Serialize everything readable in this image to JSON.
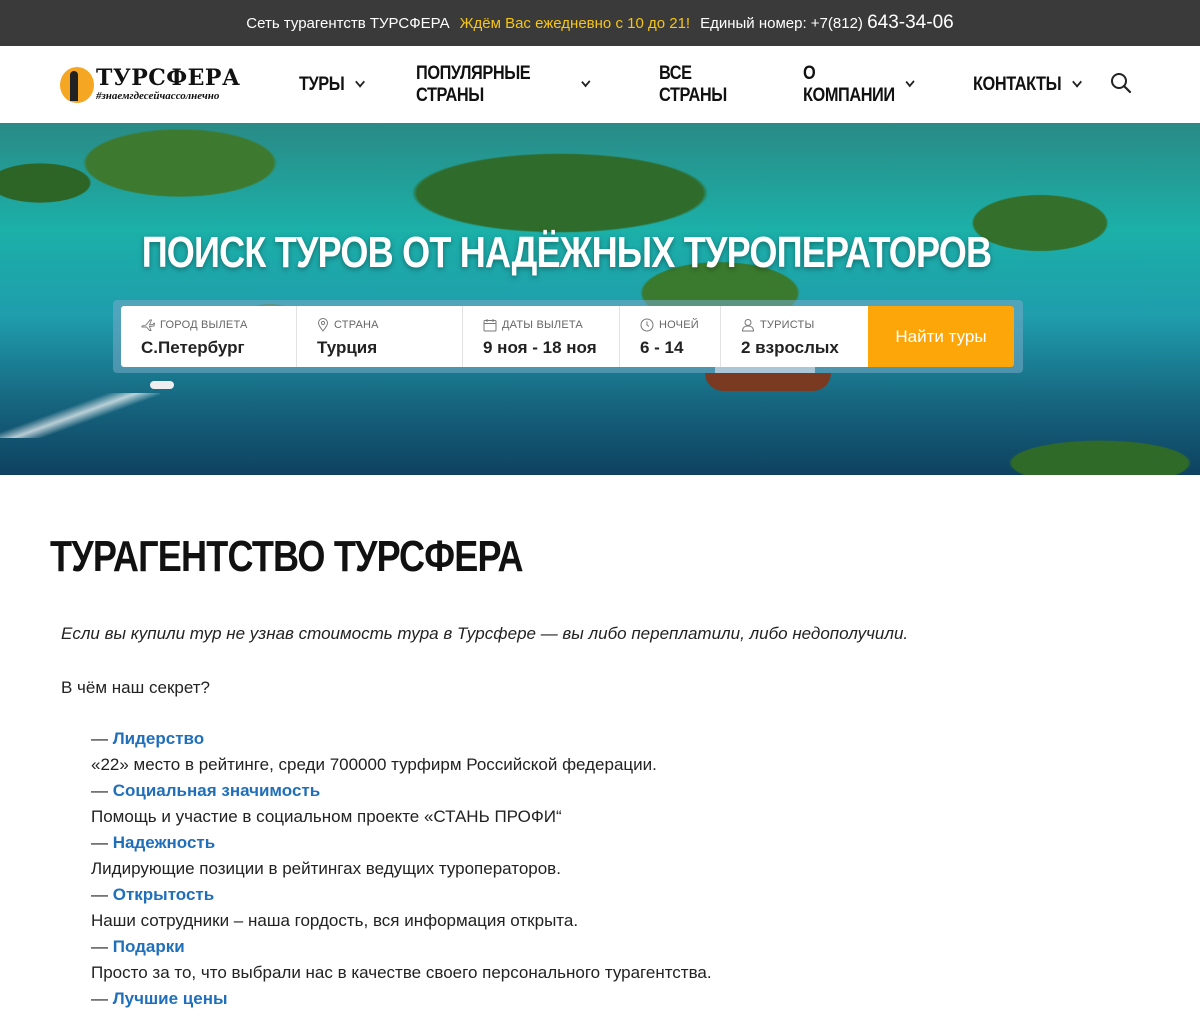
{
  "topbar": {
    "network": "Сеть турагентств ТУРСФЕРА",
    "hours": "Ждём Вас ежедневно с 10 до 21!",
    "phone_label": "Единый номер: +7(812)",
    "phone_number": "643-34-06",
    "accent_color": "#f5c518"
  },
  "header": {
    "logo_name": "ТУРСФЕРА",
    "logo_tagline": "#знаемгдесейчассолнечно",
    "nav": [
      {
        "label": "Туры"
      },
      {
        "label": "Популярные страны"
      },
      {
        "label": "Все страны"
      },
      {
        "label": "О компании"
      },
      {
        "label": "Контакты"
      }
    ],
    "search_icon": "search-icon"
  },
  "hero": {
    "title": "Поиск туров от надёжных туроператоров",
    "search": {
      "departure": {
        "label": "Город вылета",
        "value": "С.Петербург",
        "icon": "plane-icon"
      },
      "country": {
        "label": "Страна",
        "value": "Турция",
        "icon": "location-pin-icon"
      },
      "dates": {
        "label": "Даты вылета",
        "value": "9 ноя - 18 ноя",
        "icon": "calendar-icon"
      },
      "nights": {
        "label": "Ночей",
        "value": "6 - 14",
        "icon": "clock-icon"
      },
      "tourists": {
        "label": "Туристы",
        "value": "2 взрослых",
        "icon": "user-icon"
      },
      "button": "Найти туры",
      "button_color": "#fca609"
    }
  },
  "content": {
    "title": "Турагентство ТУРСФЕРА",
    "intro": "Если вы купили тур не узнав стоимость тура в Турсфере — вы либо переплатили, либо недополучили.",
    "question": "В чём наш секрет?",
    "dash": "—",
    "link_color": "#1f6fba",
    "features": [
      {
        "title": "Лидерство",
        "desc": "«22» место в рейтинге, среди 700000 турфирм Российской федерации."
      },
      {
        "title": "Социальная значимость",
        "desc": "Помощь и участие в социальном проекте «СТАНЬ ПРОФИ“"
      },
      {
        "title": "Надежность",
        "desc": "Лидирующие позиции в рейтингах ведущих туроператоров."
      },
      {
        "title": "Открытость",
        "desc": "Наши сотрудники – наша гордость, вся информация открыта."
      },
      {
        "title": "Подарки",
        "desc": "Просто за то, что выбрали нас в качестве своего персонального турагентства."
      },
      {
        "title": "Лучшие цены",
        "desc": ""
      }
    ]
  }
}
